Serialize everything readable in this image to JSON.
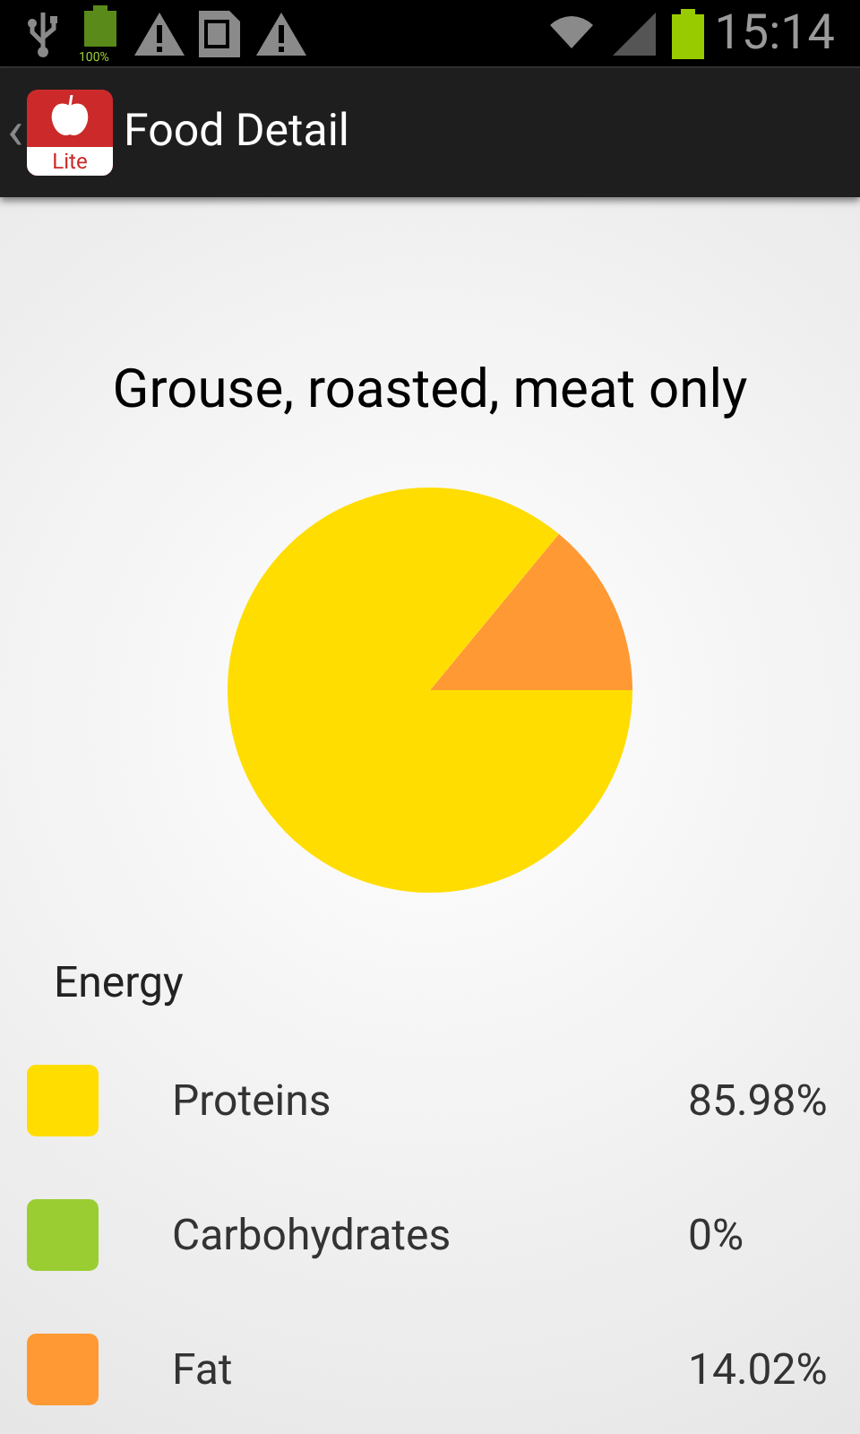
{
  "status_bar": {
    "battery_label": "100%",
    "time": "15:14"
  },
  "action_bar": {
    "back": "‹",
    "app_badge": "Lite",
    "title": "Food Detail"
  },
  "food": {
    "name": "Grouse, roasted, meat only",
    "chart_data": {
      "type": "pie",
      "categories": [
        "Proteins",
        "Carbohydrates",
        "Fat"
      ],
      "values": [
        85.98,
        0,
        14.02
      ]
    },
    "legend_title": "Energy",
    "legend": [
      {
        "value": "85.98%",
        "color": "#ffdd00"
      },
      {
        "value": "0%",
        "color": "#9acd32"
      },
      {
        "value": "14.02%",
        "color": "#ff9933"
      }
    ]
  }
}
